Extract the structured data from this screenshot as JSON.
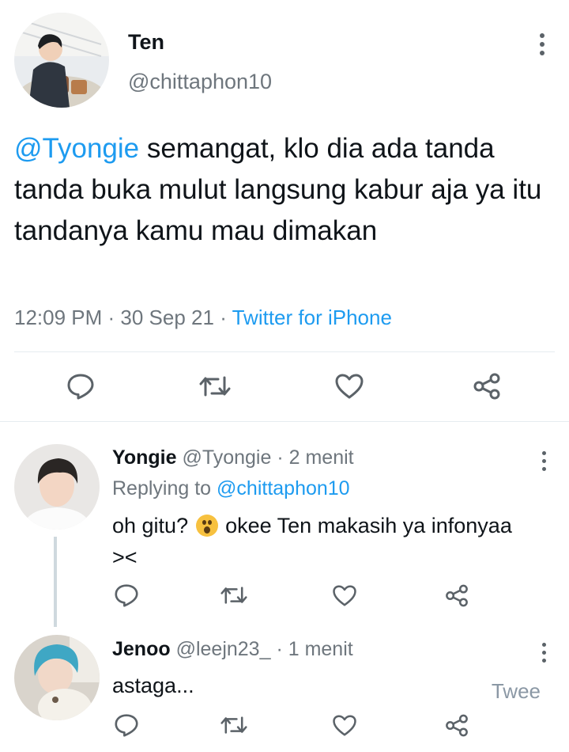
{
  "main_tweet": {
    "display_name": "Ten",
    "handle": "@chittaphon10",
    "mention": "@Tyongie",
    "text": " semangat, klo dia ada tanda tanda buka mulut langsung kabur aja ya itu tandanya kamu mau dimakan",
    "time": "12:09 PM",
    "date": "30 Sep 21",
    "source": "Twitter for iPhone",
    "separator": " · "
  },
  "replies": [
    {
      "display_name": "Yongie",
      "handle": "@Tyongie",
      "time_ago": "2 menit",
      "replying_prefix": "Replying to ",
      "replying_to": "@chittaphon10",
      "text_before_emoji": "oh gitu? ",
      "emoji": "astonished-face",
      "text_after_emoji": " okee Ten makasih ya infonyaa ><"
    },
    {
      "display_name": "Jenoo",
      "handle": "@leejn23_",
      "time_ago": "1 menit",
      "text": "astaga..."
    }
  ],
  "compose_button_label": "Twee",
  "icons": {
    "reply": "reply-icon",
    "retweet": "retweet-icon",
    "like": "like-icon",
    "share": "share-icon",
    "more": "more-icon"
  },
  "colors": {
    "link": "#1d9bf0",
    "secondary_text": "#6e767d",
    "icon": "#5b6268"
  }
}
